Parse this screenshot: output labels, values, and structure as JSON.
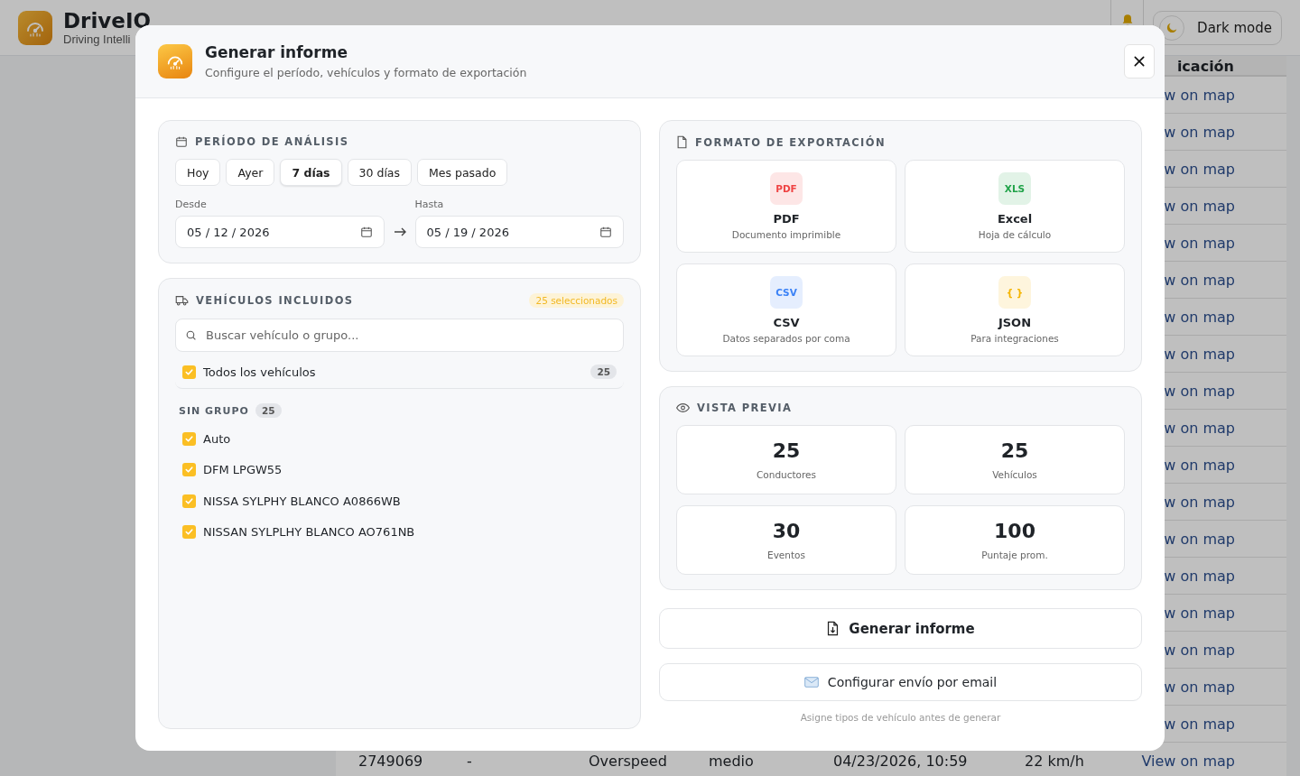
{
  "app": {
    "brand": "DriveIO",
    "tagline": "Driving Intelli",
    "dark_mode_label": "Dark mode"
  },
  "table": {
    "column_header": "icación",
    "rows": [
      {
        "link": "w on map"
      },
      {
        "link": "w on map"
      },
      {
        "link": "w on map"
      },
      {
        "link": "w on map"
      },
      {
        "link": "w on map"
      },
      {
        "link": "w on map"
      },
      {
        "link": "w on map"
      },
      {
        "link": "w on map"
      },
      {
        "link": "w on map"
      },
      {
        "link": "w on map"
      },
      {
        "link": "w on map"
      },
      {
        "link": "w on map"
      },
      {
        "link": "w on map"
      },
      {
        "link": "w on map"
      },
      {
        "link": "w on map"
      },
      {
        "link": "w on map"
      },
      {
        "link": "w on map"
      },
      {
        "link": "w on map"
      }
    ],
    "last_row": {
      "cells": [
        "2749069",
        "-",
        "Overspeed",
        "medio",
        "04/23/2026, 10:59",
        "22 km/h"
      ],
      "link": "View on map"
    }
  },
  "modal": {
    "title": "Generar informe",
    "subtitle": "Configure el período, vehículos y formato de exportación",
    "period": {
      "title": "PERÍODO DE ANÁLISIS",
      "presets": [
        {
          "label": "Hoy",
          "selected": false
        },
        {
          "label": "Ayer",
          "selected": false
        },
        {
          "label": "7 días",
          "selected": true
        },
        {
          "label": "30 días",
          "selected": false
        },
        {
          "label": "Mes pasado",
          "selected": false
        }
      ],
      "from_label": "Desde",
      "from_value": "05 / 12 / 2026",
      "to_label": "Hasta",
      "to_value": "05 / 19 / 2026"
    },
    "vehicles": {
      "title": "VEHÍCULOS INCLUIDOS",
      "badge": "25 seleccionados",
      "search_placeholder": "Buscar vehículo o grupo...",
      "all": {
        "label": "Todos los vehículos",
        "checked": true,
        "count": "25"
      },
      "groups": [
        {
          "name": "SIN GRUPO",
          "count": "25",
          "vehicles": [
            {
              "name": "Auto",
              "checked": true
            },
            {
              "name": "DFM LPGW55",
              "checked": true
            },
            {
              "name": "NISSA SYLPHY BLANCO A0866WB",
              "checked": true
            },
            {
              "name": "NISSAN SYLPLHY BLANCO AO761NB",
              "checked": true
            }
          ]
        }
      ]
    },
    "formats": {
      "title": "FORMATO DE EXPORTACIÓN",
      "items": [
        {
          "badge": "PDF",
          "name": "PDF",
          "description": "Documento imprimible",
          "color": "#ef4444"
        },
        {
          "badge": "XLS",
          "name": "Excel",
          "description": "Hoja de cálculo",
          "color": "#22a34a"
        },
        {
          "badge": "CSV",
          "name": "CSV",
          "description": "Datos separados por coma",
          "color": "#3b82f6"
        },
        {
          "badge": "{ }",
          "name": "JSON",
          "description": "Para integraciones",
          "color": "#f5b400"
        }
      ]
    },
    "preview": {
      "title": "VISTA PREVIA",
      "stats": [
        {
          "value": "25",
          "label": "Conductores"
        },
        {
          "value": "25",
          "label": "Vehículos"
        },
        {
          "value": "30",
          "label": "Eventos"
        },
        {
          "value": "100",
          "label": "Puntaje prom."
        }
      ]
    },
    "generate_label": "Generar informe",
    "email_label": "Configurar envío por email",
    "hint": "Asigne tipos de vehículo antes de generar"
  }
}
